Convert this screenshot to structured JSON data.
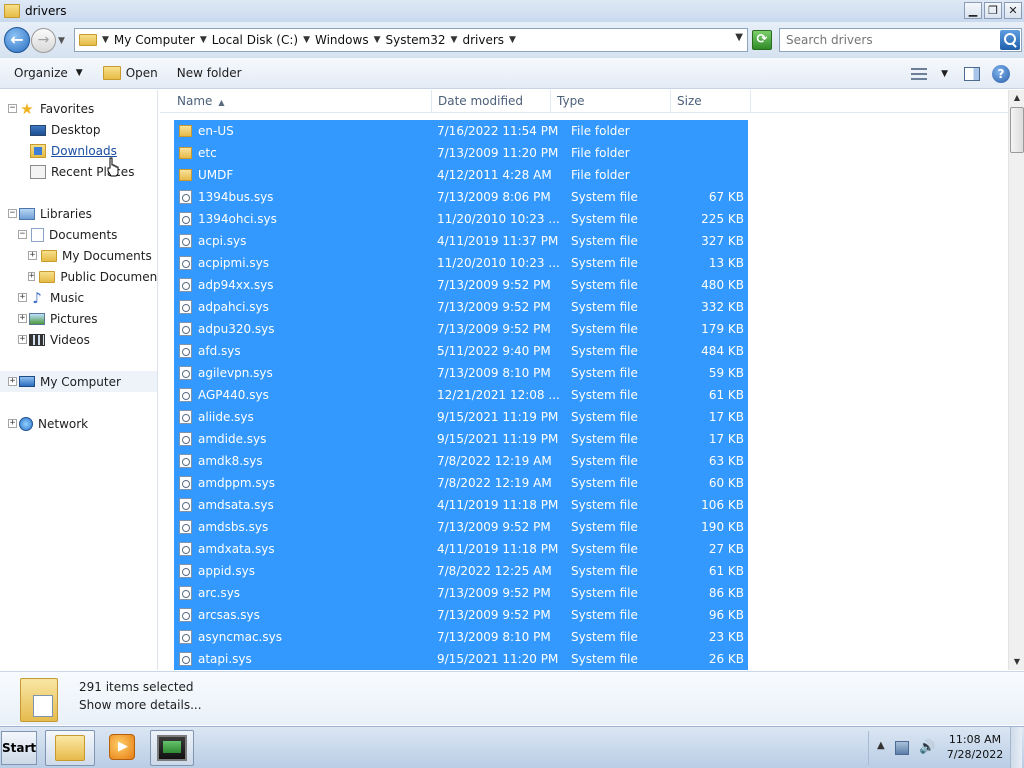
{
  "window": {
    "title": "drivers",
    "buttons": {
      "minimize": "▁",
      "restore": "❐",
      "close": "✕"
    }
  },
  "address": {
    "crumbs": [
      "My Computer",
      "Local Disk (C:)",
      "Windows",
      "System32",
      "drivers"
    ],
    "search_placeholder": "Search drivers"
  },
  "toolbar": {
    "organize": "Organize",
    "open": "Open",
    "new_folder": "New folder"
  },
  "nav": {
    "favorites": "Favorites",
    "desktop": "Desktop",
    "downloads": "Downloads",
    "recent_places": "Recent Places",
    "libraries": "Libraries",
    "documents": "Documents",
    "my_documents": "My Documents",
    "public_documents": "Public Documents",
    "music": "Music",
    "pictures": "Pictures",
    "videos": "Videos",
    "my_computer": "My Computer",
    "network": "Network"
  },
  "columns": {
    "name": "Name",
    "date_modified": "Date modified",
    "type": "Type",
    "size": "Size",
    "sorted_by": "name-ascending"
  },
  "files": [
    {
      "name": "en-US",
      "date": "7/16/2022 11:54 PM",
      "type": "File folder",
      "size": "",
      "kind": "folder"
    },
    {
      "name": "etc",
      "date": "7/13/2009 11:20 PM",
      "type": "File folder",
      "size": "",
      "kind": "folder"
    },
    {
      "name": "UMDF",
      "date": "4/12/2011 4:28 AM",
      "type": "File folder",
      "size": "",
      "kind": "folder"
    },
    {
      "name": "1394bus.sys",
      "date": "7/13/2009 8:06 PM",
      "type": "System file",
      "size": "67 KB",
      "kind": "sys"
    },
    {
      "name": "1394ohci.sys",
      "date": "11/20/2010 10:23 ...",
      "type": "System file",
      "size": "225 KB",
      "kind": "sys"
    },
    {
      "name": "acpi.sys",
      "date": "4/11/2019 11:37 PM",
      "type": "System file",
      "size": "327 KB",
      "kind": "sys"
    },
    {
      "name": "acpipmi.sys",
      "date": "11/20/2010 10:23 ...",
      "type": "System file",
      "size": "13 KB",
      "kind": "sys"
    },
    {
      "name": "adp94xx.sys",
      "date": "7/13/2009 9:52 PM",
      "type": "System file",
      "size": "480 KB",
      "kind": "sys"
    },
    {
      "name": "adpahci.sys",
      "date": "7/13/2009 9:52 PM",
      "type": "System file",
      "size": "332 KB",
      "kind": "sys"
    },
    {
      "name": "adpu320.sys",
      "date": "7/13/2009 9:52 PM",
      "type": "System file",
      "size": "179 KB",
      "kind": "sys"
    },
    {
      "name": "afd.sys",
      "date": "5/11/2022 9:40 PM",
      "type": "System file",
      "size": "484 KB",
      "kind": "sys"
    },
    {
      "name": "agilevpn.sys",
      "date": "7/13/2009 8:10 PM",
      "type": "System file",
      "size": "59 KB",
      "kind": "sys"
    },
    {
      "name": "AGP440.sys",
      "date": "12/21/2021 12:08 ...",
      "type": "System file",
      "size": "61 KB",
      "kind": "sys"
    },
    {
      "name": "aliide.sys",
      "date": "9/15/2021 11:19 PM",
      "type": "System file",
      "size": "17 KB",
      "kind": "sys"
    },
    {
      "name": "amdide.sys",
      "date": "9/15/2021 11:19 PM",
      "type": "System file",
      "size": "17 KB",
      "kind": "sys"
    },
    {
      "name": "amdk8.sys",
      "date": "7/8/2022 12:19 AM",
      "type": "System file",
      "size": "63 KB",
      "kind": "sys"
    },
    {
      "name": "amdppm.sys",
      "date": "7/8/2022 12:19 AM",
      "type": "System file",
      "size": "60 KB",
      "kind": "sys"
    },
    {
      "name": "amdsata.sys",
      "date": "4/11/2019 11:18 PM",
      "type": "System file",
      "size": "106 KB",
      "kind": "sys"
    },
    {
      "name": "amdsbs.sys",
      "date": "7/13/2009 9:52 PM",
      "type": "System file",
      "size": "190 KB",
      "kind": "sys"
    },
    {
      "name": "amdxata.sys",
      "date": "4/11/2019 11:18 PM",
      "type": "System file",
      "size": "27 KB",
      "kind": "sys"
    },
    {
      "name": "appid.sys",
      "date": "7/8/2022 12:25 AM",
      "type": "System file",
      "size": "61 KB",
      "kind": "sys"
    },
    {
      "name": "arc.sys",
      "date": "7/13/2009 9:52 PM",
      "type": "System file",
      "size": "86 KB",
      "kind": "sys"
    },
    {
      "name": "arcsas.sys",
      "date": "7/13/2009 9:52 PM",
      "type": "System file",
      "size": "96 KB",
      "kind": "sys"
    },
    {
      "name": "asyncmac.sys",
      "date": "7/13/2009 8:10 PM",
      "type": "System file",
      "size": "23 KB",
      "kind": "sys"
    },
    {
      "name": "atapi.sys",
      "date": "9/15/2021 11:20 PM",
      "type": "System file",
      "size": "26 KB",
      "kind": "sys"
    }
  ],
  "details": {
    "count": "291 items selected",
    "more": "Show more details..."
  },
  "taskbar": {
    "start": "Start",
    "time": "11:08 AM",
    "date": "7/28/2022"
  },
  "colors": {
    "selection": "#3399ff",
    "accent": "#1a4fa3"
  }
}
